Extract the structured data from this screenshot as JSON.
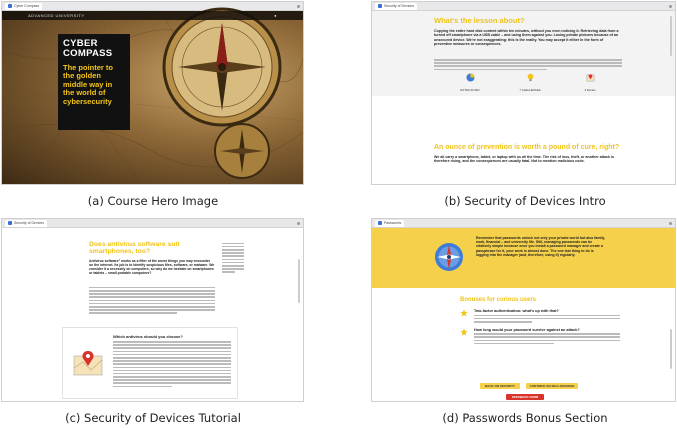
{
  "captions": {
    "a": "(a) Course Hero Image",
    "b": "(b) Security of Devices Intro",
    "c": "(c) Security of Devices Tutorial",
    "d": "(d) Passwords Bonus Section"
  },
  "hero": {
    "title_line1": "CYBER",
    "title_line2": "COMPASS",
    "subtitle": "The pointer to the golden middle way in the world of cybersecurity",
    "topbar_left": "ADVANCED UNIVERSITY"
  },
  "intro": {
    "heading1": "What's the lesson about?",
    "lead": "Copying the entire hard disk content within ten minutes, without you even noticing it. Retrieving data from a turned off smartphone via a USB cable – and using them against you. Losing private pictures because of an unsecured device. We're not exaggerating: this is the reality. You may accept it either in the form of preventive measures or consequences.",
    "stats": [
      "EXTRA 30 MIN",
      "7 CHALLENGES",
      "3 Stories"
    ],
    "heading2": "An ounce of prevention is worth a pound of cure, right?",
    "lead2": "We all carry a smartphone, tablet, or laptop with us all the time. The risk of loss, theft, or another attack is therefore rising, and the consequences are usually fatal. Not to mention malicious code."
  },
  "tutorial": {
    "heading": "Does antivirus software suit smartphones, too?",
    "lead": "Antivirus software\" works as a filter of the worst things you may encounter on the internet. Its job is to identify suspicious files, software, or malware. We consider it a necessity on computers, so why do we hesitate on smartphones or tablets – small portable computers?",
    "subheading": "Which antivirus should you choose?"
  },
  "bonus": {
    "banner": "Remember that passwords unlock not only your private world but also family, work, financial – and university life. Still, managing passwords can be relatively simple because once you install a password manager and create a passphrase for it, your work is almost done. The one last thing to do is logging into the manager (and, therefore, using it) regularly.",
    "heading": "Bonuses for curious users",
    "q1": "Two-factor authentication: what's up with that?",
    "q2": "How long would your password survive against an attack?",
    "btn_back": "BACK ON SECURITY",
    "btn_continue": "CONTINUE ON SELF-DEFENSE",
    "btn_feedback": "FEEDBACK FORM"
  },
  "colors": {
    "accent": "#f0c419",
    "banner": "#f5d04a",
    "feedback": "#d9342b"
  }
}
